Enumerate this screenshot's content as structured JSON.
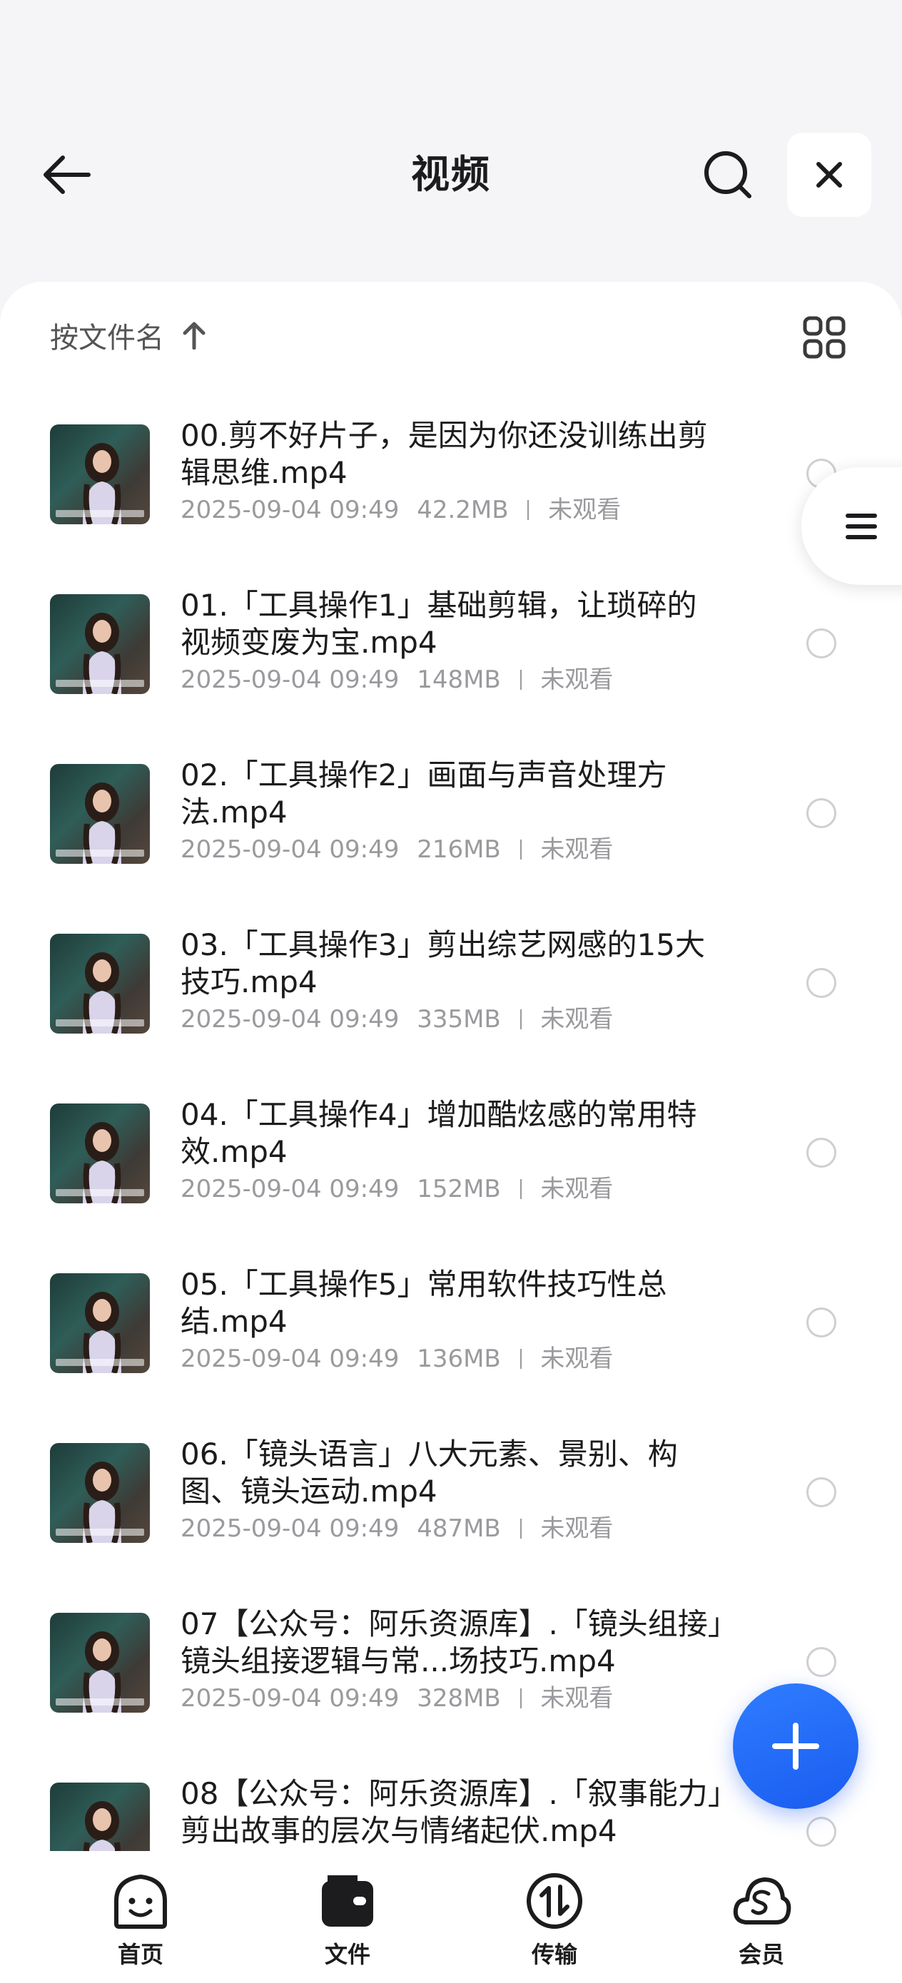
{
  "header": {
    "title": "视频",
    "back_icon": "arrow-left-icon",
    "search_icon": "search-icon",
    "close_icon": "close-icon"
  },
  "sort": {
    "label": "按文件名",
    "direction_icon": "arrow-up-icon",
    "view_icon": "grid-view-icon"
  },
  "files": [
    {
      "name": "00.剪不好片子，是因为你还没训练出剪辑思维.mp4",
      "date": "2025-09-04 09:49",
      "size": "42.2MB",
      "status": "未观看"
    },
    {
      "name": "01.「工具操作1」基础剪辑，让琐碎的视频变废为宝.mp4",
      "date": "2025-09-04 09:49",
      "size": "148MB",
      "status": "未观看"
    },
    {
      "name": "02.「工具操作2」画面与声音处理方法.mp4",
      "date": "2025-09-04 09:49",
      "size": "216MB",
      "status": "未观看"
    },
    {
      "name": "03.「工具操作3」剪出综艺网感的15大技巧.mp4",
      "date": "2025-09-04 09:49",
      "size": "335MB",
      "status": "未观看"
    },
    {
      "name": "04.「工具操作4」增加酷炫感的常用特效.mp4",
      "date": "2025-09-04 09:49",
      "size": "152MB",
      "status": "未观看"
    },
    {
      "name": "05.「工具操作5」常用软件技巧性总结.mp4",
      "date": "2025-09-04 09:49",
      "size": "136MB",
      "status": "未观看"
    },
    {
      "name": "06.「镜头语言」八大元素、景别、构图、镜头运动.mp4",
      "date": "2025-09-04 09:49",
      "size": "487MB",
      "status": "未观看"
    },
    {
      "name": "07【公众号：阿乐资源库】.「镜头组接」镜头组接逻辑与常...场技巧.mp4",
      "date": "2025-09-04 09:49",
      "size": "328MB",
      "status": "未观看"
    },
    {
      "name": "08【公众号：阿乐资源库】.「叙事能力」剪出故事的层次与情绪起伏.mp4",
      "date": "",
      "size": "",
      "status": ""
    }
  ],
  "side_handle_icon": "menu-lines-icon",
  "fab_icon": "plus-icon",
  "tabs": [
    {
      "label": "首页",
      "icon": "smile-face-icon"
    },
    {
      "label": "文件",
      "icon": "wallet-folder-icon"
    },
    {
      "label": "传输",
      "icon": "transfer-arrows-icon"
    },
    {
      "label": "会员",
      "icon": "cloud-s-icon"
    }
  ],
  "colors": {
    "accent": "#1a5cf0",
    "meta": "#9a9a9e",
    "background": "#f5f5f7"
  }
}
